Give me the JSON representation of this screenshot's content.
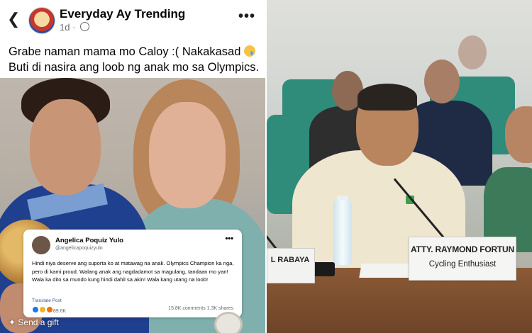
{
  "post": {
    "page_name": "Everyday Ay Trending",
    "time": "1d",
    "caption_line1": "Grabe naman mama mo Caloy :(  Nakakasad",
    "caption_line2": "Buti di nasira ang loob ng anak mo sa Olympics."
  },
  "embedded": {
    "author": "Angelica Poquiz Yulo",
    "handle": "@angelicapoquizyulo",
    "body": "Hindi niya deserve ang suporta ko at matawag na anak. Olympics Champion ka nga, pero di kami proud. Walang anak ang nagdadamot sa magulang, tandaan mo yan! Wala ka dito sa mundo kung hindi dahil sa akin! Wala kang utang na loob!",
    "translate": "Translate Post",
    "reactions": "89.6K",
    "counts": "15.8K comments  1.3K shares"
  },
  "gift_label": "Send a gift",
  "hearing": {
    "nameplate_name": "ATTY. RAYMOND FORTUN",
    "nameplate_title": "Cycling Enthusiast",
    "left_nameplate": "L RABAYA"
  },
  "icons": {
    "back": "back-arrow-icon",
    "more": "more-options-icon",
    "globe": "globe-icon",
    "gift": "gift-icon"
  },
  "colors": {
    "fb_text": "#050505",
    "fb_meta": "#65676b",
    "link": "#385898"
  }
}
